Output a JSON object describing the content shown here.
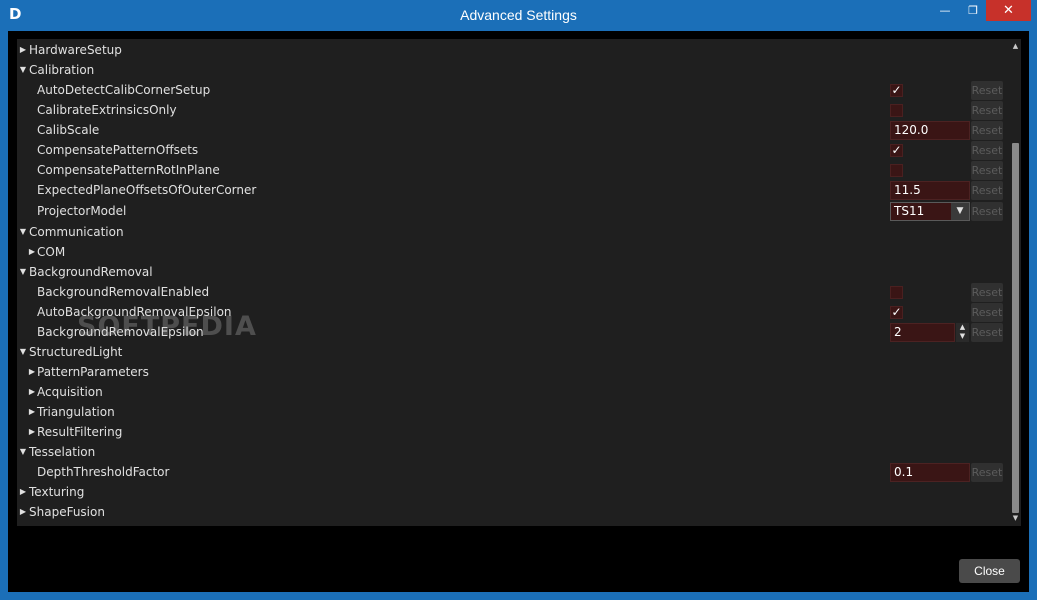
{
  "window": {
    "title": "Advanced Settings",
    "logo": "D",
    "min_glyph": "—",
    "max_glyph": "❐",
    "close_glyph": "✕"
  },
  "icons": {
    "expanded": "▼",
    "collapsed": "▶",
    "check": "✓",
    "combo_arrow": "▼",
    "spin_up": "▲",
    "spin_down": "▼",
    "scroll_up": "▲",
    "scroll_down": "▼"
  },
  "reset_label": "Reset",
  "tree": {
    "hardware_setup": "HardwareSetup",
    "calibration": "Calibration",
    "auto_detect": {
      "label": "AutoDetectCalibCornerSetup",
      "checked": true
    },
    "calib_extrinsics": {
      "label": "CalibrateExtrinsicsOnly",
      "checked": false
    },
    "calib_scale": {
      "label": "CalibScale",
      "value": "120.0"
    },
    "compensate_offsets": {
      "label": "CompensatePatternOffsets",
      "checked": true
    },
    "compensate_rot": {
      "label": "CompensatePatternRotInPlane",
      "checked": false
    },
    "expected_plane": {
      "label": "ExpectedPlaneOffsetsOfOuterCorner",
      "value": "11.5"
    },
    "projector_model": {
      "label": "ProjectorModel",
      "value": "TS11"
    },
    "communication": "Communication",
    "com": "COM",
    "background_removal": "BackgroundRemoval",
    "bg_enabled": {
      "label": "BackgroundRemovalEnabled",
      "checked": false
    },
    "auto_bg_epsilon": {
      "label": "AutoBackgroundRemovalEpsilon",
      "checked": true
    },
    "bg_epsilon": {
      "label": "BackgroundRemovalEpsilon",
      "value": "2"
    },
    "structured_light": "StructuredLight",
    "pattern_parameters": "PatternParameters",
    "acquisition": "Acquisition",
    "triangulation": "Triangulation",
    "result_filtering": "ResultFiltering",
    "tesselation": "Tesselation",
    "depth_threshold": {
      "label": "DepthThresholdFactor",
      "value": "0.1"
    },
    "texturing": "Texturing",
    "shape_fusion": "ShapeFusion"
  },
  "watermark": "SOFTPEDIA",
  "close_label": "Close"
}
